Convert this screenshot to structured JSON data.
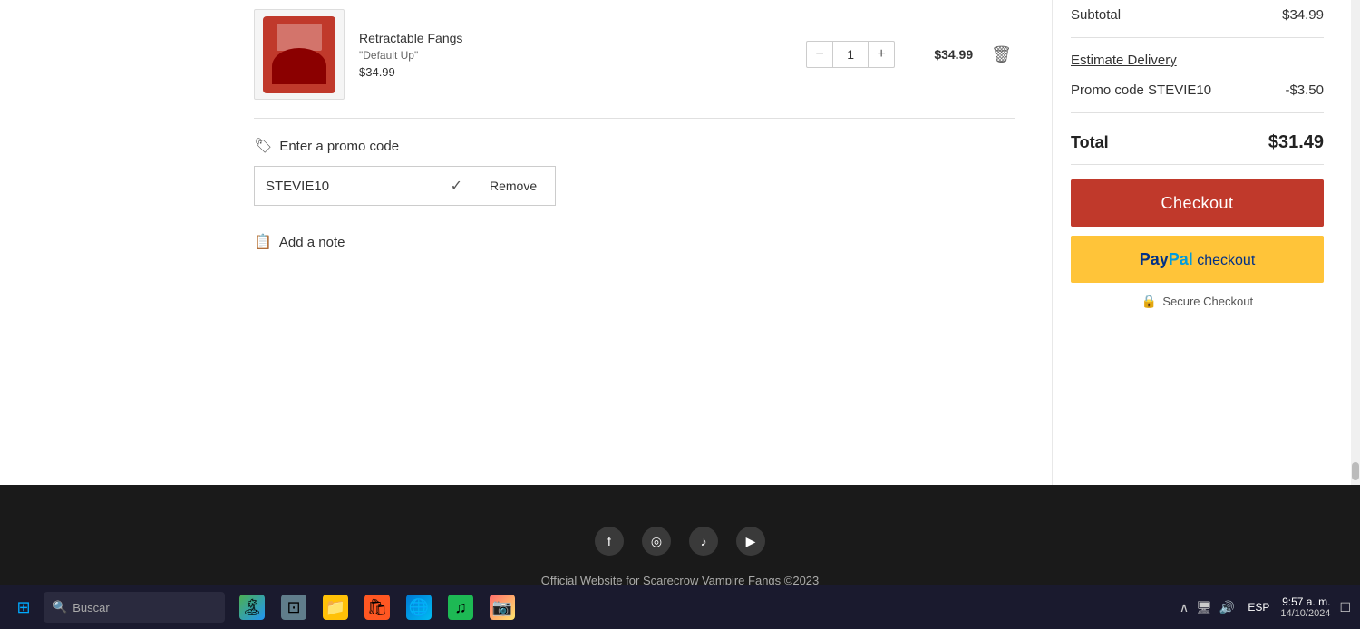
{
  "product": {
    "title": "Retractable Fangs",
    "variant": "\"Default Up\"",
    "price": "$34.99",
    "quantity": "1",
    "total_price": "$34.99"
  },
  "promo": {
    "label": "Enter a promo code",
    "code_value": "STEVIE10",
    "remove_label": "Remove",
    "promo_code_display": "STEVIE10",
    "discount": "-$3.50"
  },
  "note": {
    "label": "Add a note"
  },
  "summary": {
    "subtotal_label": "Subtotal",
    "subtotal_value": "$34.99",
    "delivery_label": "Estimate Delivery",
    "promo_label": "Promo code STEVIE10",
    "promo_value": "-$3.50",
    "total_label": "Total",
    "total_value": "$31.49",
    "checkout_label": "Checkout",
    "paypal_label": "paypal checkout",
    "secure_checkout": "Secure Checkout"
  },
  "footer": {
    "copyright": "Official Website for Scarecrow Vampire Fangs ©2023",
    "social_icons": [
      "facebook",
      "instagram",
      "tiktok",
      "youtube"
    ]
  },
  "taskbar": {
    "search_placeholder": "Buscar",
    "lang": "ESP",
    "time": "9:57 a. m.",
    "date": "14/10/2024"
  }
}
